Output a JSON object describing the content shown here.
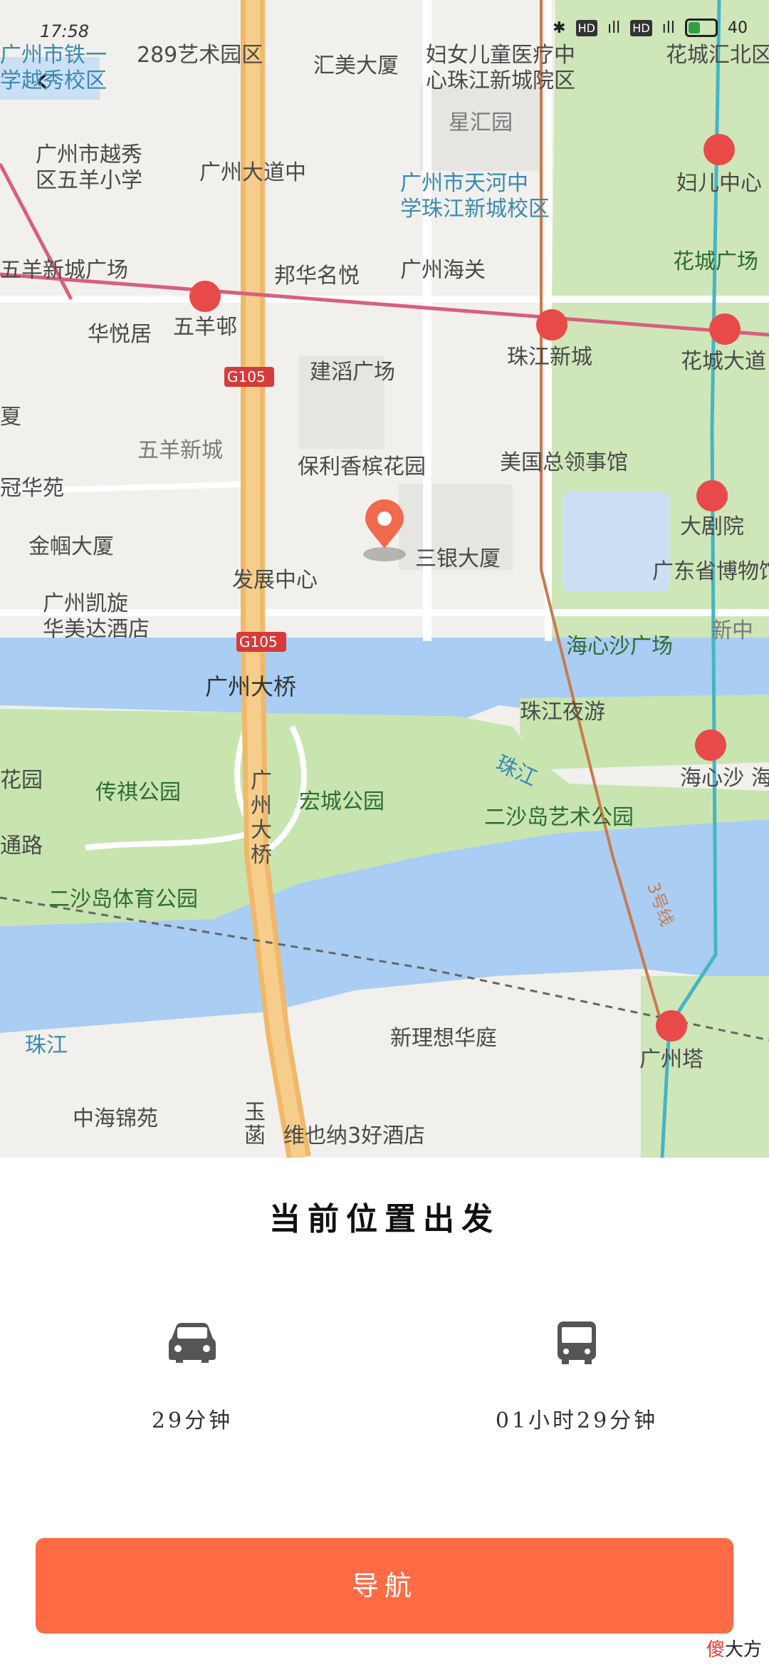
{
  "status_bar": {
    "time": "17:58",
    "bluetooth": "✱",
    "hd1": "HD",
    "signal1": "ıll",
    "hd2": "HD",
    "signal2": "ıll",
    "battery_text": "40"
  },
  "map": {
    "pois": {
      "p1": "289艺术园区",
      "p2": "汇美大厦",
      "p3": "妇女儿童医疗中\n心珠江新城院区",
      "p4": "花城汇北区",
      "p5": "广州市铁一\n学越秀校区",
      "p6": "星汇园",
      "p7": "广州市越秀\n区五羊小学",
      "p8": "广州大道中",
      "p9": "广州市天河中\n学珠江新城校区",
      "p10": "妇儿中心",
      "p11": "五羊新城广场",
      "p12": "邦华名悦",
      "p13": "广州海关",
      "p14": "花城广场",
      "p15": "华悦居",
      "p16": "五羊邨",
      "p17": "珠江新城",
      "p18": "花城大道",
      "p19": "G105",
      "p20": "建滔广场",
      "p21": "夏",
      "p22": "五羊新城",
      "p23": "保利香槟花园",
      "p24": "美国总领事馆",
      "p25": "冠华苑",
      "p26": "大剧院",
      "p27": "金帼大厦",
      "p28": "三银大厦",
      "p29": "发展中心",
      "p30": "广东省博物馆",
      "p31": "广州凯旋\n华美达酒店",
      "p32": "G105",
      "p33": "海心沙广场",
      "p34": "新中",
      "p35": "广州大桥",
      "p36": "珠江夜游",
      "p37": "珠江",
      "p38": "海心沙",
      "p39": "海",
      "p40": "花园",
      "p41": "传祺公园",
      "p42": "广\n州\n大\n桥",
      "p43": "宏城公园",
      "p44": "二沙岛艺术公园",
      "p45": "通路",
      "p46": "二沙岛体育公园",
      "p47": "3号线",
      "p48": "珠江",
      "p49": "新理想华庭",
      "p50": "广州塔",
      "p51": "中海锦苑",
      "p52": "维也纳3好酒店",
      "p53": "玉\n菡"
    }
  },
  "back_icon": "‹",
  "sheet": {
    "title": "当前位置出发",
    "car_time": "29分钟",
    "bus_time": "01小时29分钟",
    "nav_label": "导航"
  },
  "watermark": {
    "a": "傻",
    "b": "大方"
  },
  "colors": {
    "accent": "#ff6b45",
    "water": "#a9cdf3",
    "park": "#c8e5b0",
    "road": "#f0b86a",
    "metro_red": "#e84a4a"
  }
}
